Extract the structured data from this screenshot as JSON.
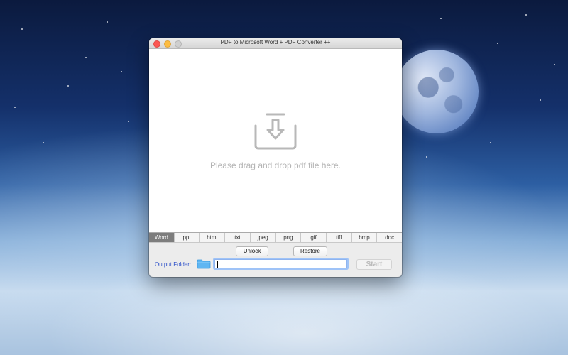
{
  "window": {
    "title": "PDF to Microsoft Word + PDF Converter ++"
  },
  "dropzone": {
    "icon": "download-tray-icon",
    "text": "Please drag and drop pdf file here."
  },
  "tabs": [
    {
      "label": "Word",
      "active": true
    },
    {
      "label": "ppt",
      "active": false
    },
    {
      "label": "html",
      "active": false
    },
    {
      "label": "txt",
      "active": false
    },
    {
      "label": "jpeg",
      "active": false
    },
    {
      "label": "png",
      "active": false
    },
    {
      "label": "gif",
      "active": false
    },
    {
      "label": "tiff",
      "active": false
    },
    {
      "label": "bmp",
      "active": false
    },
    {
      "label": "doc",
      "active": false
    }
  ],
  "controls": {
    "unlock_label": "Unlock",
    "restore_label": "Restore",
    "output_folder_label": "Output Folder:",
    "output_folder_value": "",
    "start_label": "Start"
  },
  "colors": {
    "active_tab": "#7d7d7d",
    "output_label": "#2c4fc9",
    "folder_icon": "#5fb6f2"
  }
}
